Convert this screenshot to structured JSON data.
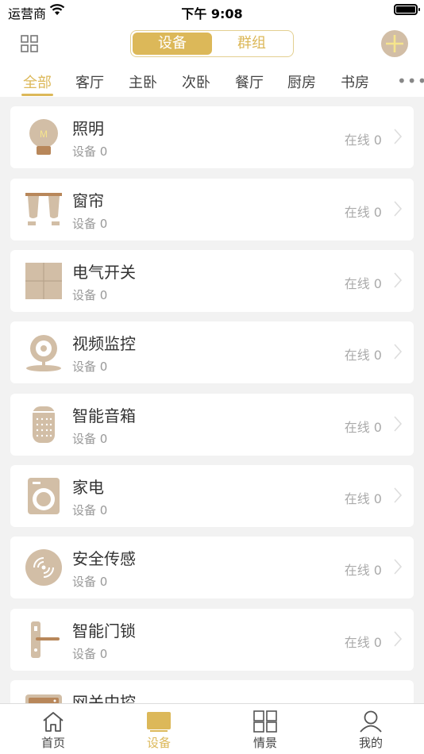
{
  "status_bar": {
    "carrier": "运营商",
    "time": "下午 9:08"
  },
  "nav": {
    "segments": [
      "设备",
      "群组"
    ],
    "active_segment": "设备"
  },
  "tabs": [
    "全部",
    "客厅",
    "主卧",
    "次卧",
    "餐厅",
    "厨房",
    "书房"
  ],
  "active_tab": "全部",
  "more": "•••",
  "categories": [
    {
      "title": "照明",
      "subtitle": "设备 0",
      "status": "在线 0",
      "icon": "bulb-icon"
    },
    {
      "title": "窗帘",
      "subtitle": "设备 0",
      "status": "在线 0",
      "icon": "curtain-icon"
    },
    {
      "title": "电气开关",
      "subtitle": "设备 0",
      "status": "在线 0",
      "icon": "switch-icon"
    },
    {
      "title": "视频监控",
      "subtitle": "设备 0",
      "status": "在线 0",
      "icon": "camera-icon"
    },
    {
      "title": "智能音箱",
      "subtitle": "设备 0",
      "status": "在线 0",
      "icon": "speaker-icon"
    },
    {
      "title": "家电",
      "subtitle": "设备 0",
      "status": "在线 0",
      "icon": "appliance-icon"
    },
    {
      "title": "安全传感",
      "subtitle": "设备 0",
      "status": "在线 0",
      "icon": "sensor-icon"
    },
    {
      "title": "智能门锁",
      "subtitle": "设备 0",
      "status": "在线 0",
      "icon": "door-lock-icon"
    },
    {
      "title": "网关中控",
      "subtitle": "",
      "status": "",
      "icon": "gateway-icon"
    }
  ],
  "bottom_tabs": [
    {
      "label": "首页",
      "icon": "home-icon"
    },
    {
      "label": "设备",
      "icon": "device-icon"
    },
    {
      "label": "情景",
      "icon": "scene-icon"
    },
    {
      "label": "我的",
      "icon": "profile-icon"
    }
  ],
  "active_bottom_tab": "设备",
  "colors": {
    "accent": "#dcb859",
    "icon_tan": "#d2bea6",
    "icon_brown": "#b8875a",
    "background": "#f2f2f2"
  }
}
